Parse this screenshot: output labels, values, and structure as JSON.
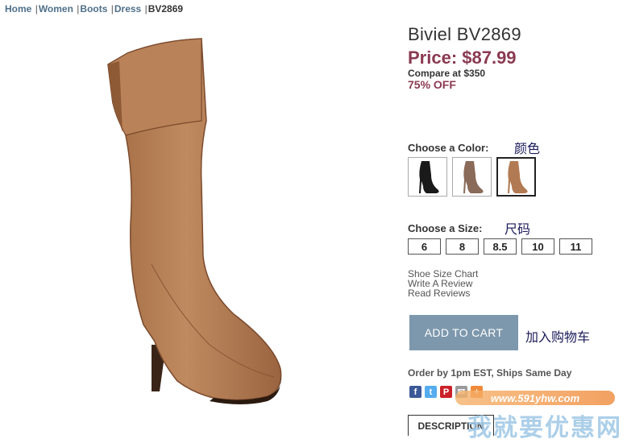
{
  "breadcrumb": {
    "items": [
      "Home",
      "Women",
      "Boots",
      "Dress"
    ],
    "current": "BV2869",
    "separator": "|"
  },
  "product": {
    "title": "Biviel BV2869",
    "price": "Price: $87.99",
    "compare": "Compare at $350",
    "discount": "75% OFF"
  },
  "color": {
    "label": "Choose a Color:",
    "annotation": "颜色",
    "swatches": [
      {
        "name": "black",
        "color": "#1a1a1a",
        "selected": false
      },
      {
        "name": "taupe",
        "color": "#8a6a58",
        "selected": false
      },
      {
        "name": "tan",
        "color": "#b27a52",
        "selected": true
      }
    ]
  },
  "size": {
    "label": "Choose a Size:",
    "annotation": "尺码",
    "options": [
      "6",
      "8",
      "8.5",
      "10",
      "11"
    ]
  },
  "links": {
    "size_chart": "Shoe Size Chart",
    "write_review": "Write A Review",
    "read_reviews": "Read Reviews"
  },
  "cart": {
    "button_label": "ADD TO CART",
    "annotation": "加入购物车"
  },
  "shipping": "Order by 1pm EST, Ships Same Day",
  "social": [
    {
      "name": "facebook-icon",
      "glyph": "f",
      "color": "#3b5998"
    },
    {
      "name": "twitter-icon",
      "glyph": "t",
      "color": "#55acee"
    },
    {
      "name": "pinterest-icon",
      "glyph": "P",
      "color": "#cb2027"
    },
    {
      "name": "email-icon",
      "glyph": "✉",
      "color": "#9a9a9a"
    },
    {
      "name": "share-plus-icon",
      "glyph": "+",
      "color": "#f08a3a"
    }
  ],
  "tabs": {
    "description": "DESCRIPTION"
  },
  "watermark": {
    "url": "www.591yhw.com",
    "text": "我就要优惠网"
  },
  "colors": {
    "accent_price": "#8a3a52",
    "link": "#4f6f8a",
    "button": "#7d98ad",
    "boot": "#b07a50"
  }
}
